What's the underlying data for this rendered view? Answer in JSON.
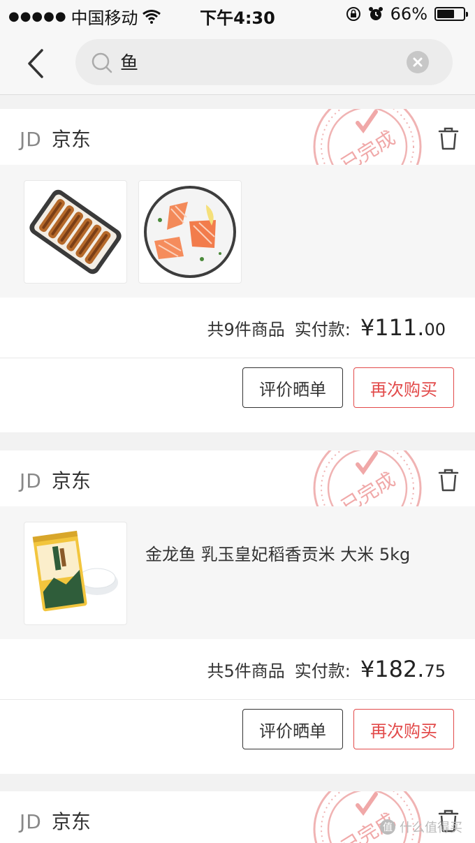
{
  "status_bar": {
    "signal": "●●●●●",
    "carrier": "中国移动",
    "time": "下午4:30",
    "battery": "66%",
    "battery_level": 0.66
  },
  "search": {
    "query": "鱼"
  },
  "orders": [
    {
      "shop_logo": "JD",
      "shop_name": "京东",
      "stamp": "已完成",
      "count_text": "共9件商品",
      "paid_label": "实付款:",
      "price_main": "¥111.",
      "price_cents": "00",
      "review_label": "评价晒单",
      "rebuy_label": "再次购买",
      "product_title": ""
    },
    {
      "shop_logo": "JD",
      "shop_name": "京东",
      "stamp": "已完成",
      "count_text": "共5件商品",
      "paid_label": "实付款:",
      "price_main": "¥182.",
      "price_cents": "75",
      "review_label": "评价晒单",
      "rebuy_label": "再次购买",
      "product_title": "金龙鱼 乳玉皇妃稻香贡米 大米 5kg"
    },
    {
      "shop_logo": "JD",
      "shop_name": "京东",
      "stamp": "已完成"
    }
  ],
  "watermark": {
    "badge": "值",
    "text": "什么值得买"
  },
  "colors": {
    "accent_red": "#e24a4a",
    "stamp_red": "#f0b3b3",
    "background": "#f2f2f2"
  }
}
